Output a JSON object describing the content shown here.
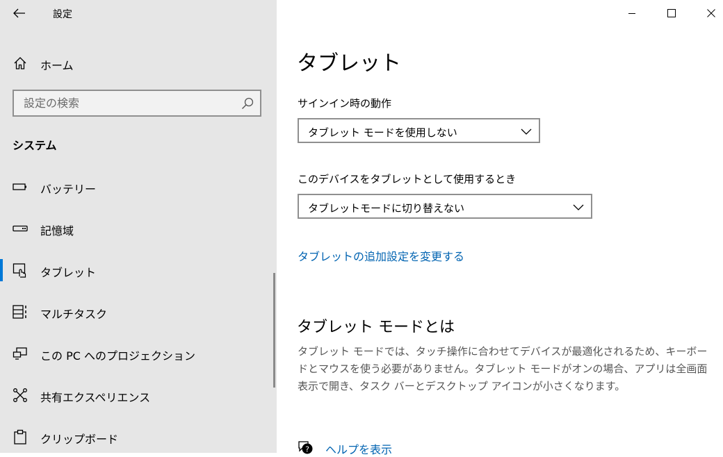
{
  "app": {
    "title": "設定"
  },
  "sidebar": {
    "home_label": "ホーム",
    "search": {
      "placeholder": "設定の検索",
      "value": ""
    },
    "section_header": "システム",
    "items": [
      {
        "label": "バッテリー",
        "icon": "battery-icon",
        "active": false
      },
      {
        "label": "記憶域",
        "icon": "storage-icon",
        "active": false
      },
      {
        "label": "タブレット",
        "icon": "tablet-icon",
        "active": true
      },
      {
        "label": "マルチタスク",
        "icon": "multitasking-icon",
        "active": false
      },
      {
        "label": "この PC へのプロジェクション",
        "icon": "projection-icon",
        "active": false
      },
      {
        "label": "共有エクスペリエンス",
        "icon": "shared-experiences-icon",
        "active": false
      },
      {
        "label": "クリップボード",
        "icon": "clipboard-icon",
        "active": false
      }
    ]
  },
  "main": {
    "title": "タブレット",
    "signin_label": "サインイン時の動作",
    "signin_value": "タブレット モードを使用しない",
    "as_tablet_label": "このデバイスをタブレットとして使用するとき",
    "as_tablet_value": "タブレットモードに切り替えない",
    "additional_link": "タブレットの追加設定を変更する",
    "about_title": "タブレット モードとは",
    "about_text": "タブレット モードでは、タッチ操作に合わせてデバイスが最適化されるため、キーボードとマウスを使う必要がありません。タブレット モードがオンの場合、アプリは全画面表示で開き、タスク バーとデスクトップ アイコンが小さくなります。",
    "help_link": "ヘルプを表示"
  },
  "colors": {
    "accent": "#0078d7",
    "link": "#0063b1",
    "sidebar_bg": "#e6e6e6"
  }
}
